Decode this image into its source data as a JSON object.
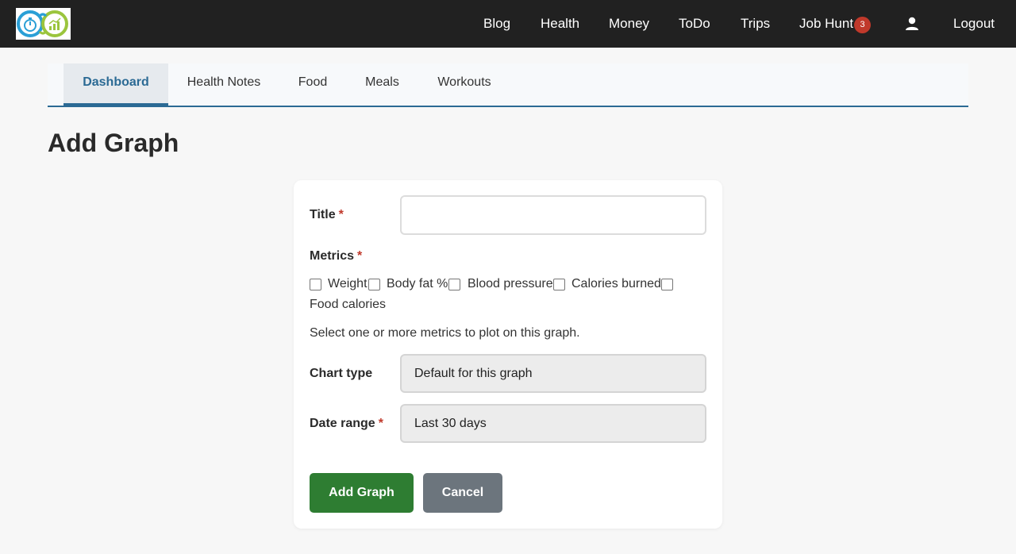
{
  "header": {
    "nav": [
      "Blog",
      "Health",
      "Money",
      "ToDo",
      "Trips",
      "Job Hunt"
    ],
    "job_hunt_badge": "3",
    "logout": "Logout"
  },
  "tabs": [
    "Dashboard",
    "Health Notes",
    "Food",
    "Meals",
    "Workouts"
  ],
  "page": {
    "title": "Add Graph"
  },
  "form": {
    "title_label": "Title",
    "title_value": "",
    "required_mark": "*",
    "metrics_label": "Metrics",
    "metrics": [
      "Weight",
      "Body fat %",
      "Blood pressure",
      "Calories burned",
      "Food calories"
    ],
    "metrics_help": "Select one or more metrics to plot on this graph.",
    "chart_type_label": "Chart type",
    "chart_type_value": "Default for this graph",
    "date_range_label": "Date range",
    "date_range_value": "Last 30 days",
    "submit_label": "Add Graph",
    "cancel_label": "Cancel"
  },
  "colors": {
    "topbar": "#212121",
    "accent": "#2b6a94",
    "primary_button": "#2e7d32",
    "secondary_button": "#6c757d",
    "badge": "#c0392b"
  },
  "icons": {
    "logo": "stopwatch-chart-logo",
    "user": "user-icon"
  }
}
